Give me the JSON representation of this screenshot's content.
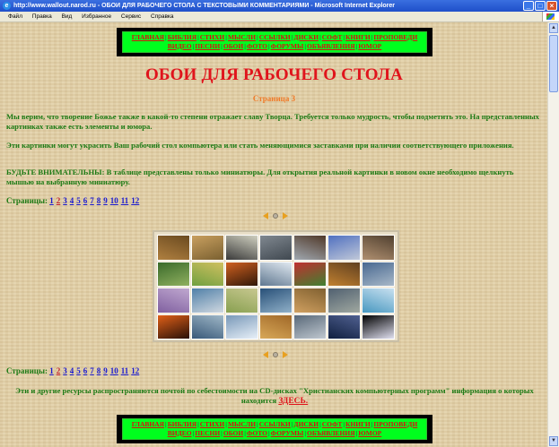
{
  "window": {
    "title": "http://www.wallout.narod.ru - ОБОИ ДЛЯ РАБОЧЕГО СТОЛА С ТЕКСТОВЫМИ КОММЕНТАРИЯМИ - Microsoft Internet Explorer",
    "minimize": "_",
    "maximize": "□",
    "close": "×"
  },
  "menu": [
    "Файл",
    "Правка",
    "Вид",
    "Избранное",
    "Сервис",
    "Справка"
  ],
  "nav": {
    "row1": [
      "ГЛАВНАЯ",
      "БИБЛИЯ",
      "СТИХИ",
      "МЫСЛИ",
      "ССЫЛКИ",
      "ДИСКИ",
      "СОФТ",
      "КНИГИ",
      "ПРОПОВЕДИ"
    ],
    "row2": [
      "ВИДЕО",
      "ПЕСНИ",
      "ОБОИ",
      "ФОТО",
      "ФОРУМЫ",
      "ОБЪЯВЛЕНИЯ",
      "ЮМОР"
    ]
  },
  "page": {
    "title": "ОБОИ ДЛЯ РАБОЧЕГО СТОЛА",
    "subtitle": "Страница 3",
    "para1": "Мы верим, что творение Божье также в какой-то степени отражает славу Творца. Требуется только мудрость, чтобы подметить это. На представленных картинках также есть элементы и юмора.",
    "para2": "Эти картинки могут украсить Ваш рабочий стол компьютера или стать меняющимися заставками при наличии соответствующего приложения.",
    "para3": "БУДЬТЕ ВНИМАТЕЛЬНЫ: В таблице представлены только миниатюры. Для открытия реальной картинки в новом окне необходимо щелкнуть мышью на выбранную миниатюру.",
    "pages_label": "Страницы:",
    "pages": [
      "1",
      "2",
      "3",
      "4",
      "5",
      "6",
      "7",
      "8",
      "9",
      "10",
      "11",
      "12"
    ],
    "footer_text": "Эти и другие ресурсы распространяются почтой по себестоимости на CD-дисках \"Христианских компьютерных программ\" информация о которых находится",
    "footer_link": "ЗДЕСЬ."
  },
  "thumbnails": [
    {
      "name": "lion",
      "colors": [
        "#b08040",
        "#6a4a20"
      ]
    },
    {
      "name": "leopards",
      "colors": [
        "#c9a060",
        "#7a6030"
      ]
    },
    {
      "name": "cave-light",
      "colors": [
        "#3a3a3a",
        "#d0d0c0"
      ]
    },
    {
      "name": "wolf",
      "colors": [
        "#808890",
        "#404850"
      ]
    },
    {
      "name": "horses",
      "colors": [
        "#a0a8b0",
        "#503828"
      ]
    },
    {
      "name": "mountain-sky",
      "colors": [
        "#5070c0",
        "#c0c8d8"
      ]
    },
    {
      "name": "elephants",
      "colors": [
        "#b09070",
        "#504030"
      ]
    },
    {
      "name": "forest",
      "colors": [
        "#3a6a2a",
        "#90b060"
      ]
    },
    {
      "name": "flowers-field",
      "colors": [
        "#70a040",
        "#d0c060"
      ]
    },
    {
      "name": "sunset-trees",
      "colors": [
        "#d06020",
        "#301808"
      ]
    },
    {
      "name": "waterfall",
      "colors": [
        "#607890",
        "#e0e8f0"
      ]
    },
    {
      "name": "tulips",
      "colors": [
        "#c03030",
        "#408030"
      ]
    },
    {
      "name": "autumn-forest",
      "colors": [
        "#c08030",
        "#604020"
      ]
    },
    {
      "name": "mountain-lake",
      "colors": [
        "#486890",
        "#a8b8c8"
      ]
    },
    {
      "name": "lavender",
      "colors": [
        "#8060a0",
        "#c0a8d0"
      ]
    },
    {
      "name": "coast",
      "colors": [
        "#5080a8",
        "#d0d8e0"
      ]
    },
    {
      "name": "field-road",
      "colors": [
        "#88a050",
        "#c8c890"
      ]
    },
    {
      "name": "ocean-wave",
      "colors": [
        "#285078",
        "#90b0c8"
      ]
    },
    {
      "name": "desert",
      "colors": [
        "#d0a060",
        "#806030"
      ]
    },
    {
      "name": "rocks-sea",
      "colors": [
        "#506070",
        "#a0a8a0"
      ]
    },
    {
      "name": "island",
      "colors": [
        "#4898c0",
        "#c8e0f0"
      ]
    },
    {
      "name": "red-sunset",
      "colors": [
        "#e06018",
        "#281008"
      ]
    },
    {
      "name": "sea-storm",
      "colors": [
        "#385878",
        "#a0b8c8"
      ]
    },
    {
      "name": "glacier",
      "colors": [
        "#7898b8",
        "#e8f0f8"
      ]
    },
    {
      "name": "dunes",
      "colors": [
        "#d8a858",
        "#a06828"
      ]
    },
    {
      "name": "lighthouse",
      "colors": [
        "#586878",
        "#c0c8d0"
      ]
    },
    {
      "name": "night-sky",
      "colors": [
        "#102040",
        "#506090"
      ]
    },
    {
      "name": "moonlight",
      "colors": [
        "#000000",
        "#e0e0f0"
      ]
    }
  ]
}
